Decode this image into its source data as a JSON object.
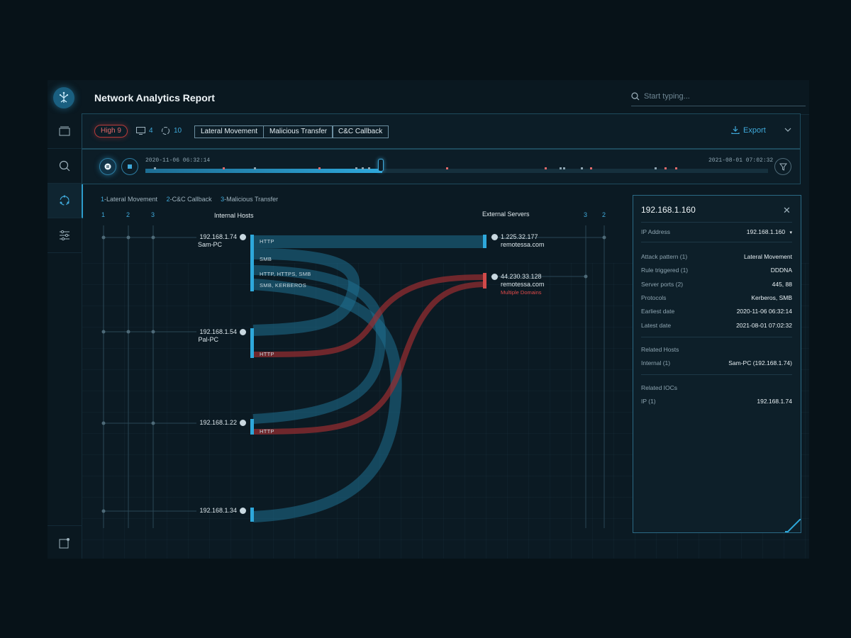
{
  "app": {
    "title": "Network Analytics Report"
  },
  "search": {
    "placeholder": "Start typing..."
  },
  "filters": {
    "severity_label": "High 9",
    "hosts_count": "4",
    "servers_count": "10",
    "tags": [
      "Lateral Movement",
      "Malicious Transfer",
      "C&C Callback"
    ],
    "export_label": "Export"
  },
  "timeline": {
    "start_date": "2020-11-06 06:32:14",
    "end_date": "2021-08-01 07:02:32",
    "progress": 0.38
  },
  "legend": {
    "items": [
      {
        "num": "1",
        "label": "-Lateral Movement"
      },
      {
        "num": "2",
        "label": "-C&C Callback"
      },
      {
        "num": "3",
        "label": "-Malicious Transfer"
      }
    ]
  },
  "graph": {
    "left_cols": [
      "1",
      "2",
      "3"
    ],
    "right_cols": [
      "3",
      "2"
    ],
    "internal_header": "Internal Hosts",
    "external_header": "External Servers",
    "hosts": [
      {
        "ip": "192.168.1.74",
        "name": "Sam-PC"
      },
      {
        "ip": "192.168.1.54",
        "name": "Pal-PC"
      },
      {
        "ip": "192.168.1.22",
        "name": ""
      },
      {
        "ip": "192.168.1.34",
        "name": ""
      }
    ],
    "servers": [
      {
        "ip": "1.225.32.177",
        "domain": "remotessa.com",
        "note": ""
      },
      {
        "ip": "44.230.33.128",
        "domain": "remotessa.com",
        "note": "Multiple Domains"
      }
    ],
    "protocols": {
      "p1": "HTTP",
      "p2": "SMB",
      "p3": "HTTP, HTTPS, SMB",
      "p4": "SMB, KERBEROS",
      "p5": "HTTP",
      "p6": "HTTP"
    }
  },
  "detail": {
    "title": "192.168.1.160",
    "ip_label": "IP Address",
    "ip_value": "192.168.1.160",
    "rows": [
      {
        "label": "Attack pattern (1)",
        "value": "Lateral Movement"
      },
      {
        "label": "Rule triggered (1)",
        "value": "DDDNA"
      },
      {
        "label": "Server ports (2)",
        "value": "445, 88"
      },
      {
        "label": "Protocols",
        "value": "Kerberos, SMB"
      },
      {
        "label": "Earliest date",
        "value": "2020-11-06 06:32:14"
      },
      {
        "label": "Latest date",
        "value": "2021-08-01 07:02:32"
      }
    ],
    "related_hosts_label": "Related Hosts",
    "internal_label": "Internal (1)",
    "internal_value": "Sam-PC (192.168.1.74)",
    "related_iocs_label": "Related IOCs",
    "ioc_label": "IP (1)",
    "ioc_value": "192.168.1.74"
  },
  "colors": {
    "accent": "#2ea8db",
    "danger": "#c0393b",
    "flow_blue": "#1f6f8f",
    "background": "#0b1a23"
  }
}
